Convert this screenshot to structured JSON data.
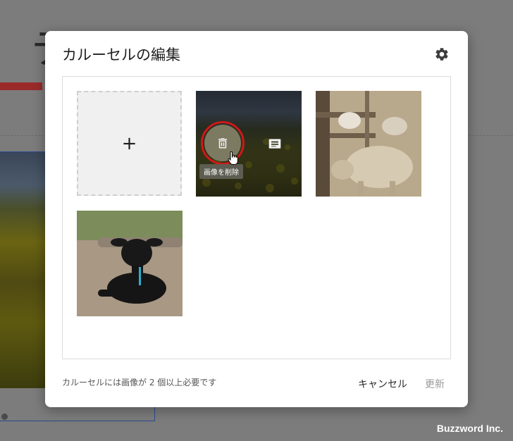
{
  "background": {
    "title_char": "テ"
  },
  "modal": {
    "title": "カルーセルの編集",
    "settings_icon": "gear-icon",
    "add_tile": {
      "icon": "plus-icon",
      "label": "+"
    },
    "images": [
      {
        "name": "rapeseed-field-photo",
        "tooltip": "画像を削除",
        "delete_icon": "trash-icon",
        "edit_icon": "caption-icon"
      },
      {
        "name": "sheep-photo"
      },
      {
        "name": "black-lamb-photo"
      }
    ],
    "footer_note": "カルーセルには画像が 2 個以上必要です",
    "cancel_label": "キャンセル",
    "update_label": "更新"
  },
  "watermark": "Buzzword Inc.",
  "colors": {
    "overlay": "#7c7c7c",
    "highlight_ring": "#d01818",
    "disabled_text": "#9a9a9a"
  }
}
